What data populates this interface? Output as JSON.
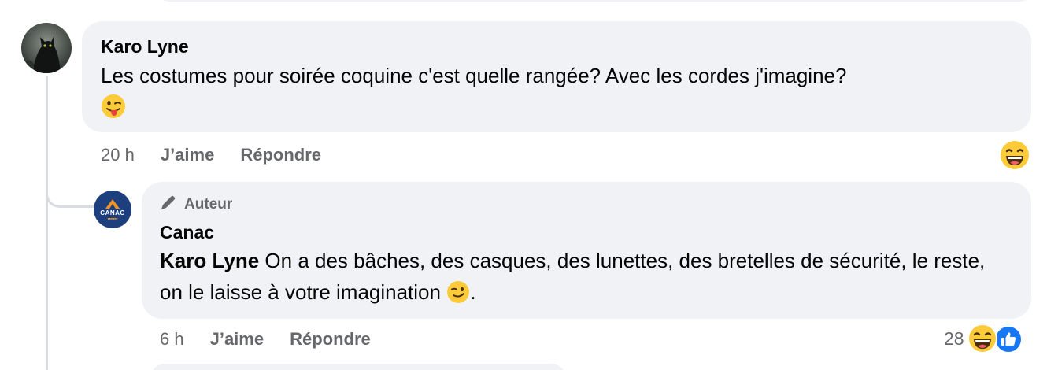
{
  "comment": {
    "author": "Karo Lyne",
    "text": "Les costumes pour soirée coquine c'est quelle rangée? Avec les cordes j'imagine?",
    "emoji": "winking-tongue-face",
    "time": "20 h",
    "like_label": "J’aime",
    "reply_label": "Répondre",
    "reaction": "laughing-face"
  },
  "reply": {
    "role_label": "Auteur",
    "author": "Canac",
    "logo_text": "CANAC",
    "mention": "Karo Lyne",
    "text": " On a des bâches, des casques, des lunettes, des bretelles de sécurité, le reste, on le laisse à votre imagination ",
    "text_end": ".",
    "emoji": "smirking-face",
    "time": "6 h",
    "like_label": "J’aime",
    "reply_label": "Répondre",
    "reaction_count": "28",
    "reactions": [
      "laughing-face",
      "like-icon"
    ]
  },
  "colors": {
    "bubble": "#f0f2f5",
    "secondary_text": "#65676b",
    "like_blue": "#1877f2",
    "canac_navy": "#1e3f7e",
    "canac_orange": "#f7941d"
  }
}
